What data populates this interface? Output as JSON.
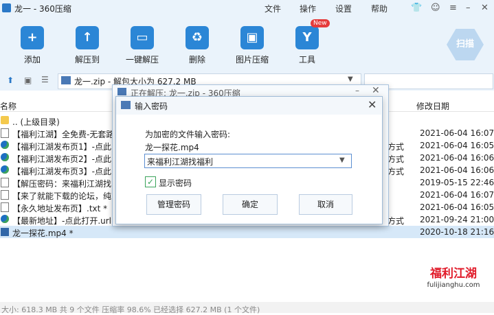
{
  "window": {
    "title": "龙一 - 360压缩"
  },
  "menu": {
    "items": [
      "文件",
      "操作",
      "设置",
      "帮助"
    ]
  },
  "toolbar": {
    "buttons": [
      "添加",
      "解压到",
      "一键解压",
      "删除",
      "图片压缩",
      "工具"
    ],
    "new_badge": "New",
    "scan_label": "扫描"
  },
  "address": {
    "value": "龙一.zip - 解包大小为 627.2 MB"
  },
  "columns": {
    "name": "名称",
    "date": "修改日期"
  },
  "files": [
    {
      "name": ".. (上级目录)",
      "date": "",
      "extra": "",
      "icon": "folder-icon"
    },
    {
      "name": "【福利江湖】全免费-无套路",
      "date": "2021-06-04 16:07",
      "extra": "",
      "icon": "text-file-icon"
    },
    {
      "name": "【福利江湖发布页1】-点此",
      "date": "2021-06-04 16:05",
      "extra": "方式",
      "icon": "globe-icon"
    },
    {
      "name": "【福利江湖发布页2】-点此",
      "date": "2021-06-04 16:06",
      "extra": "方式",
      "icon": "globe-icon"
    },
    {
      "name": "【福利江湖发布页3】-点此",
      "date": "2021-06-04 16:06",
      "extra": "方式",
      "icon": "globe-icon"
    },
    {
      "name": "【解压密码：来福利江湖找",
      "date": "2019-05-15 22:46",
      "extra": "",
      "icon": "text-file-icon"
    },
    {
      "name": "【来了就能下载的论坛，纯",
      "date": "2021-06-04 16:07",
      "extra": "",
      "icon": "text-file-icon"
    },
    {
      "name": "【永久地址发布页】.txt *",
      "date": "2021-06-04 16:05",
      "extra": "",
      "icon": "text-file-icon"
    },
    {
      "name": "【最新地址】-点此打开.url",
      "date": "2021-09-24 21:00",
      "extra": "方式",
      "icon": "globe-icon"
    },
    {
      "name": "龙一探花.mp4 *",
      "date": "2020-10-18 21:16",
      "extra": "",
      "icon": "video-file-icon"
    }
  ],
  "status": {
    "text": "大小: 618.3 MB 共 9 个文件 压缩率 98.6% 已经选择 627.2 MB (1 个文件)"
  },
  "back_dialog": {
    "title": "正在解压: 龙一.zip - 360压缩"
  },
  "dialog": {
    "title": "输入密码",
    "prompt": "为加密的文件输入密码:",
    "filename": "龙一探花.mp4",
    "password_value": "来福利江湖找福利",
    "show_password_label": "显示密码",
    "show_password_checked": true,
    "buttons": {
      "manage": "管理密码",
      "ok": "确定",
      "cancel": "取消"
    }
  },
  "watermark": {
    "logo": "福利江湖",
    "url": "fulijianghu.com"
  }
}
